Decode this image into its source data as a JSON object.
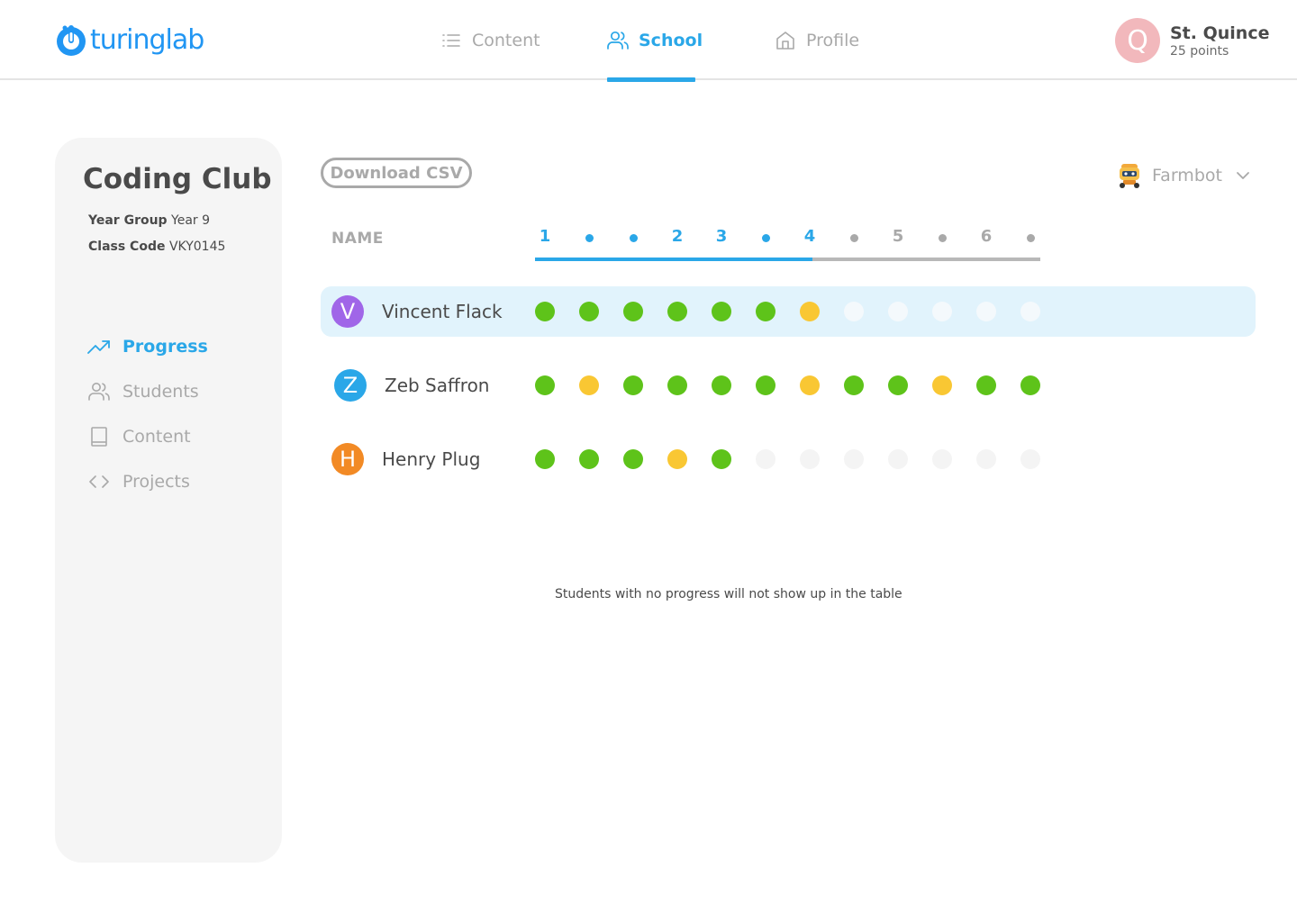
{
  "brand": {
    "name": "turinglab"
  },
  "nav": {
    "items": [
      {
        "label": "Content",
        "icon": "list-icon",
        "active": false
      },
      {
        "label": "School",
        "icon": "users-icon",
        "active": true
      },
      {
        "label": "Profile",
        "icon": "home-icon",
        "active": false
      }
    ]
  },
  "user": {
    "initial": "Q",
    "name": "St. Quince",
    "points": "25 points"
  },
  "sidebar": {
    "class_title": "Coding Club",
    "year_group_label": "Year Group",
    "year_group_value": "Year 9",
    "class_code_label": "Class Code",
    "class_code_value": "VKY0145",
    "menu": [
      {
        "label": "Progress",
        "icon": "trend-up-icon",
        "active": true
      },
      {
        "label": "Students",
        "icon": "users-icon",
        "active": false
      },
      {
        "label": "Content",
        "icon": "book-icon",
        "active": false
      },
      {
        "label": "Projects",
        "icon": "code-icon",
        "active": false
      }
    ]
  },
  "toolbar": {
    "download_label": "Download CSV",
    "course": "Farmbot"
  },
  "table": {
    "name_header": "NAME",
    "columns": [
      {
        "type": "number",
        "label": "1",
        "state": "done"
      },
      {
        "type": "dot",
        "label": "",
        "state": "done"
      },
      {
        "type": "dot",
        "label": "",
        "state": "done"
      },
      {
        "type": "number",
        "label": "2",
        "state": "done"
      },
      {
        "type": "number",
        "label": "3",
        "state": "done"
      },
      {
        "type": "dot",
        "label": "",
        "state": "done"
      },
      {
        "type": "number",
        "label": "4",
        "state": "done"
      },
      {
        "type": "dot",
        "label": "",
        "state": "todo"
      },
      {
        "type": "number",
        "label": "5",
        "state": "todo"
      },
      {
        "type": "dot",
        "label": "",
        "state": "todo"
      },
      {
        "type": "number",
        "label": "6",
        "state": "todo"
      },
      {
        "type": "dot",
        "label": "",
        "state": "todo"
      }
    ],
    "students": [
      {
        "initial": "V",
        "name": "Vincent Flack",
        "avatar_color": "#a066e8",
        "highlight": true,
        "progress": [
          "complete",
          "complete",
          "complete",
          "complete",
          "complete",
          "complete",
          "partial",
          "none",
          "none",
          "none",
          "none",
          "none"
        ]
      },
      {
        "initial": "Z",
        "name": "Zeb Saffron",
        "avatar_color": "#2aa7e8",
        "highlight": false,
        "progress": [
          "complete",
          "partial",
          "complete",
          "complete",
          "complete",
          "complete",
          "partial",
          "complete",
          "complete",
          "partial",
          "complete",
          "complete"
        ]
      },
      {
        "initial": "H",
        "name": "Henry Plug",
        "avatar_color": "#f28a25",
        "highlight": false,
        "progress": [
          "complete",
          "complete",
          "complete",
          "partial",
          "complete",
          "none",
          "none",
          "none",
          "none",
          "none",
          "none",
          "none"
        ]
      }
    ],
    "footnote": "Students with no progress will not show up in the table"
  },
  "colors": {
    "accent": "#2aa7e8",
    "complete": "#5ec31a",
    "partial": "#f9c733",
    "none_light": "#f4f4f4",
    "none_highlight": "#f4f9fc",
    "muted": "#a9a9a9"
  }
}
